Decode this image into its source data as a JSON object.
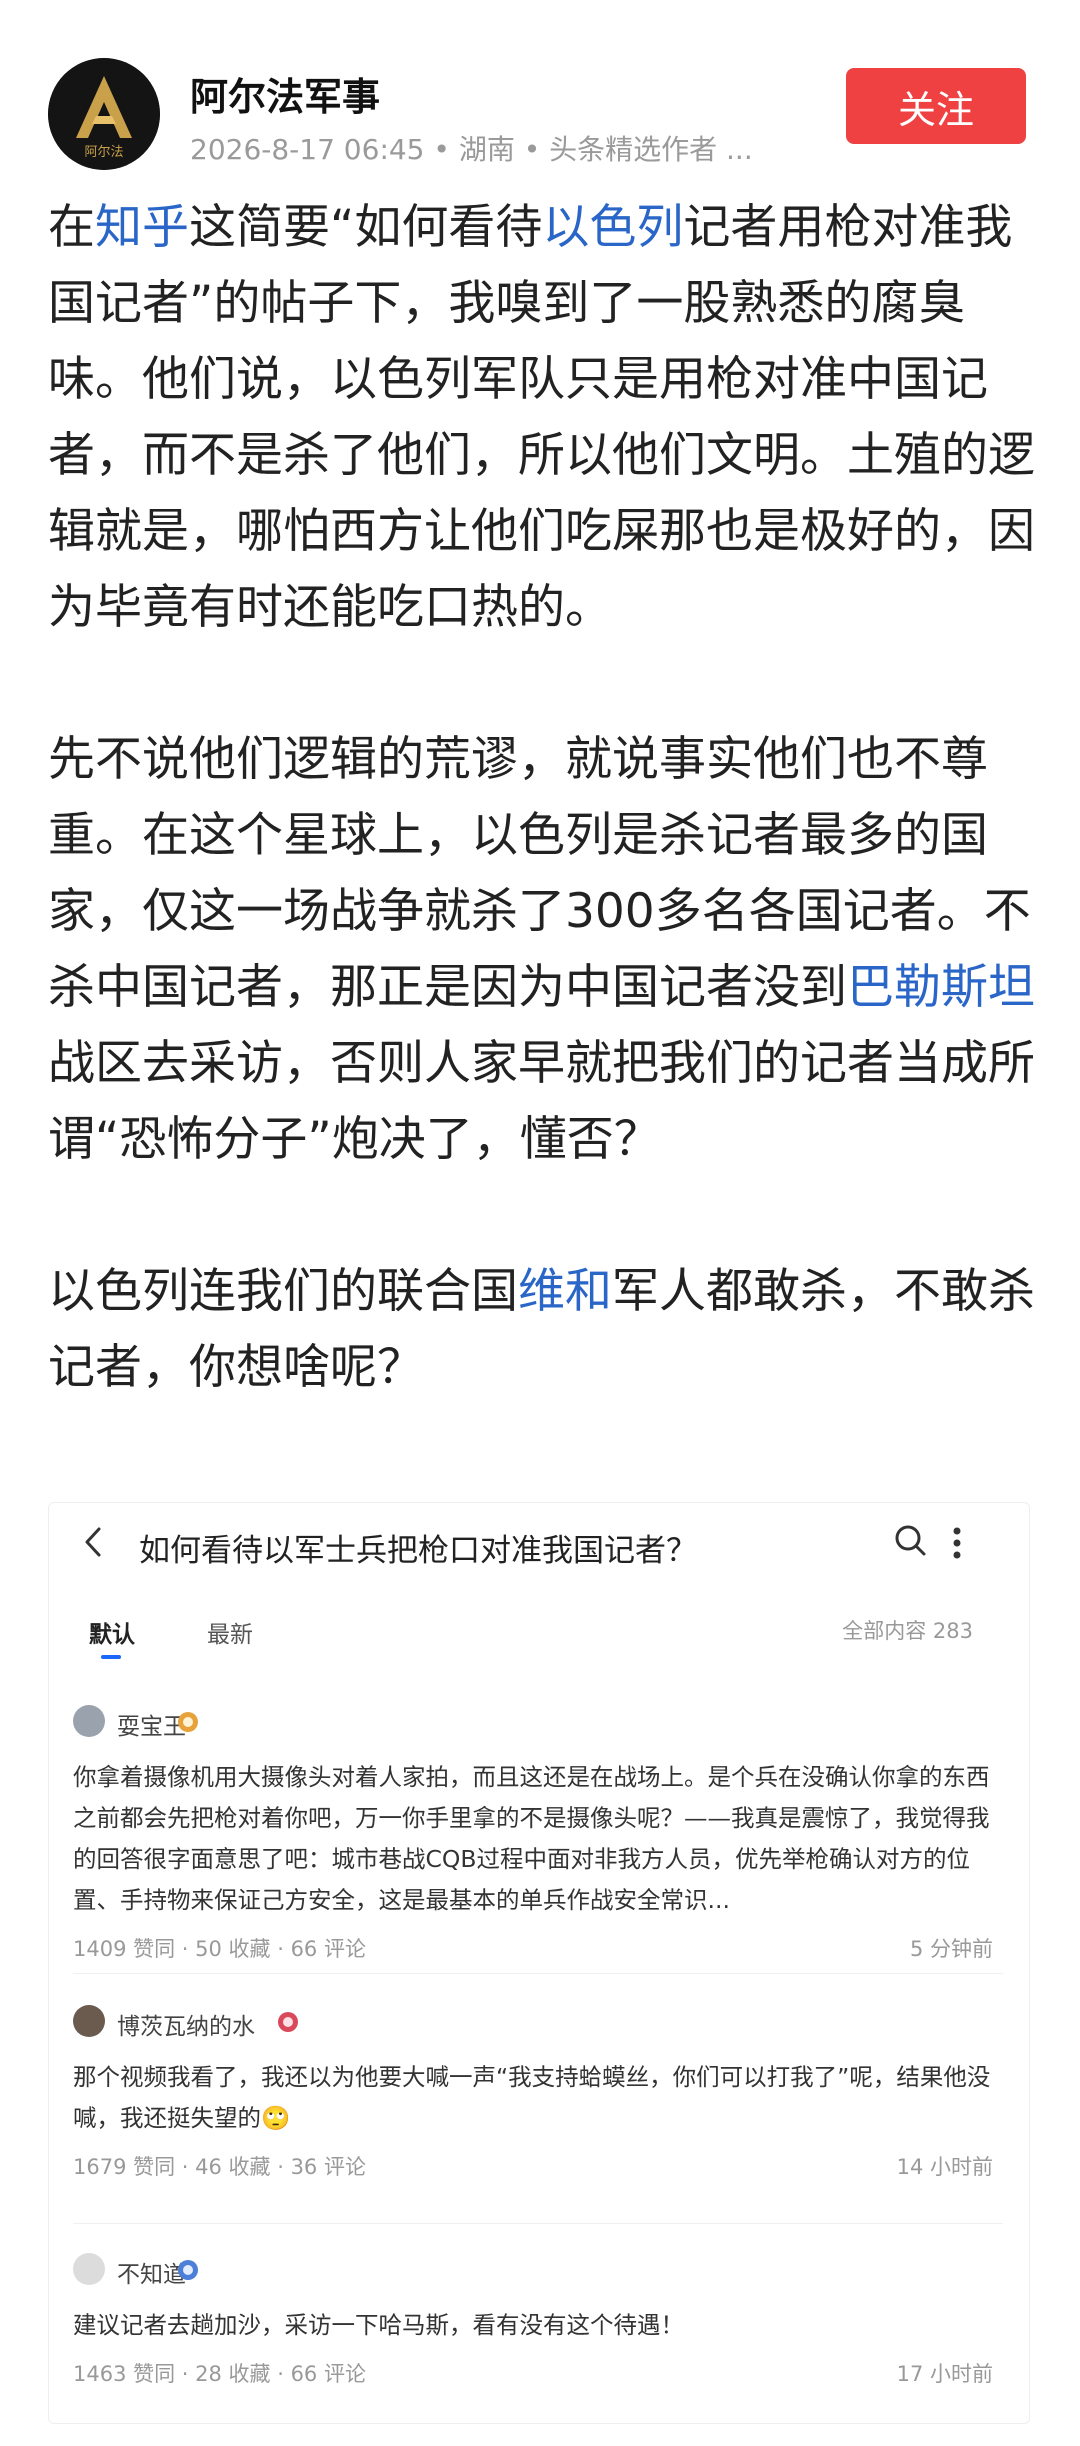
{
  "header": {
    "author_name": "阿尔法军事",
    "author_meta": "2026-8-17 06:45 • 湖南 • 头条精选作者 ...",
    "follow_label": "关注",
    "logo_text": "阿尔法"
  },
  "article": {
    "p1": {
      "t1": "在",
      "link1": "知乎",
      "t2": "这简要“如何看待",
      "link2": "以色列",
      "t3": "记者用枪对准我国记者”的帖子下，我嗅到了一股熟悉的腐臭味。他们说，以色列军队只是用枪对准中国记者，而不是杀了他们，所以他们文明。土殖的逻辑就是，哪怕西方让他们吃屎那也是极好的，因为毕竟有时还能吃口热的。"
    },
    "p2": {
      "t1": "先不说他们逻辑的荒谬，就说事实他们也不尊重。在这个星球上，以色列是杀记者最多的国家，仅这一场战争就杀了300多名各国记者。不杀中国记者，那正是因为中国记者没到",
      "link1": "巴勒斯坦",
      "t2": "战区去采访，否则人家早就把我们的记者当成所谓“恐怖分子”炮决了，懂否？"
    },
    "p3": {
      "t1": "以色列连我们的联合国",
      "link1": "维和",
      "t2": "军人都敢杀，不敢杀记者，你想啥呢？"
    }
  },
  "embedded": {
    "question_title": "如何看待以军士兵把枪口对准我国记者？",
    "tabs": [
      "默认",
      "最新"
    ],
    "total_label": "全部内容 283",
    "answers": [
      {
        "user": "耍宝王",
        "text": "你拿着摄像机用大摄像头对着人家拍，而且这还是在战场上。是个兵在没确认你拿的东西之前都会先把枪对着你吧，万一你手里拿的不是摄像头呢？——我真是震惊了，我觉得我的回答很字面意思了吧：城市巷战CQB过程中面对非我方人员，优先举枪确认对方的位置、手持物来保证己方安全，这是最基本的单兵作战安全常识...",
        "stats": "1409 赞同 · 50 收藏 · 66 评论",
        "time": "5 分钟前"
      },
      {
        "user": "博茨瓦纳的水",
        "text": "那个视频我看了，我还以为他要大喊一声“我支持蛤蟆丝，你们可以打我了”呢，结果他没喊，我还挺失望的🙄",
        "stats": "1679 赞同 · 46 收藏 · 36 评论",
        "time": "14 小时前"
      },
      {
        "user": "不知道",
        "text": "建议记者去趟加沙，采访一下哈马斯，看有没有这个待遇！",
        "stats": "1463 赞同 · 28 收藏 · 66 评论",
        "time": "17 小时前"
      }
    ]
  },
  "colors": {
    "accent_red": "#f04142",
    "link_blue": "#2a66c8",
    "tab_blue": "#1a66ff",
    "meta_gray": "#9a9a9a"
  }
}
